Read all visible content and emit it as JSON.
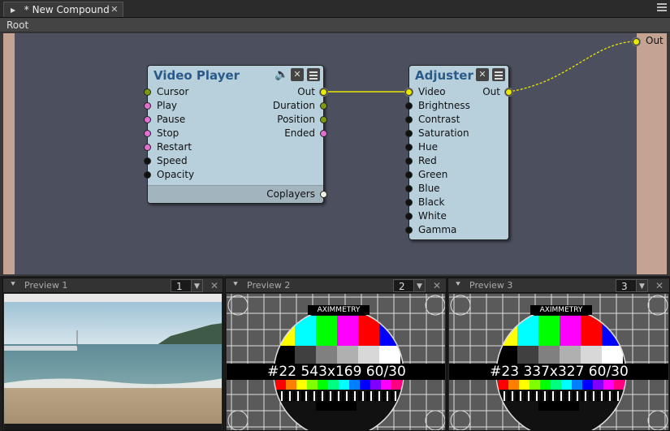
{
  "tab": {
    "title": "* New Compound",
    "close": "✕"
  },
  "breadcrumb": "Root",
  "nodes": {
    "video_player": {
      "title": "Video Player",
      "inputs": [
        "Cursor",
        "Play",
        "Pause",
        "Stop",
        "Restart",
        "Speed",
        "Opacity"
      ],
      "outputs": [
        "Out",
        "Duration",
        "Position",
        "Ended"
      ],
      "footer_output": "Coplayers"
    },
    "adjuster": {
      "title": "Adjuster",
      "output": "Out",
      "inputs": [
        "Video",
        "Brightness",
        "Contrast",
        "Saturation",
        "Hue",
        "Red",
        "Green",
        "Blue",
        "Black",
        "White",
        "Gamma"
      ]
    }
  },
  "compound_output": "Out",
  "icons": {
    "close": "✕",
    "speaker": "🔈",
    "pin": "⯆",
    "dropdown": "▼",
    "tab_arrow": "▶"
  },
  "previews": [
    {
      "title": "Preview 1",
      "number": "1",
      "close": "✕"
    },
    {
      "title": "Preview 2",
      "number": "2",
      "close": "✕",
      "brand": "AXIMMETRY",
      "info": "#22 543x169 60/30"
    },
    {
      "title": "Preview 3",
      "number": "3",
      "close": "✕",
      "brand": "AXIMMETRY",
      "info": "#23 337x327 60/30"
    }
  ],
  "colors": {
    "node_bg": "#b8d0dc",
    "node_title": "#2a5a8a",
    "canvas_bg": "#4b4f5e",
    "strip": "#c4a392",
    "connection": "#e8e800"
  }
}
